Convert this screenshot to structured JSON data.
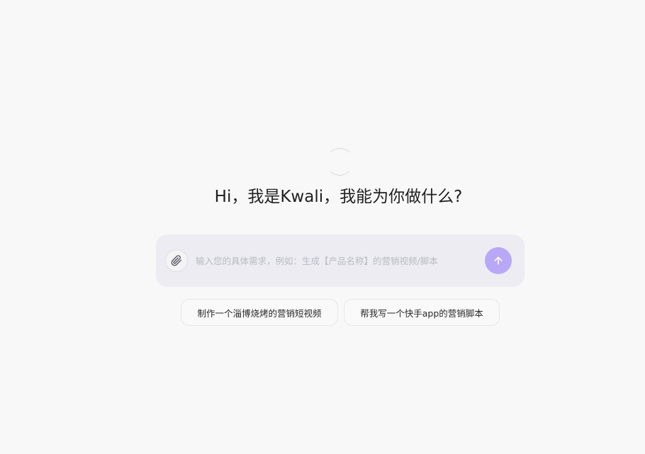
{
  "greeting": "Hi，我是Kwali，我能为你做什么?",
  "input": {
    "placeholder": "输入您的具体需求，例如：生成【产品名称】的营销视频/脚本",
    "value": ""
  },
  "icons": {
    "attach": "paperclip-icon",
    "send": "arrow-up-icon",
    "logo": "kwali-logo"
  },
  "suggestions": [
    {
      "label": "制作一个淄博烧烤的营销短视频"
    },
    {
      "label": "帮我写一个快手app的营销脚本"
    }
  ],
  "colors": {
    "background": "#f8f8f8",
    "input_bg": "#ececf2",
    "send_button": "#b9a7f7"
  }
}
